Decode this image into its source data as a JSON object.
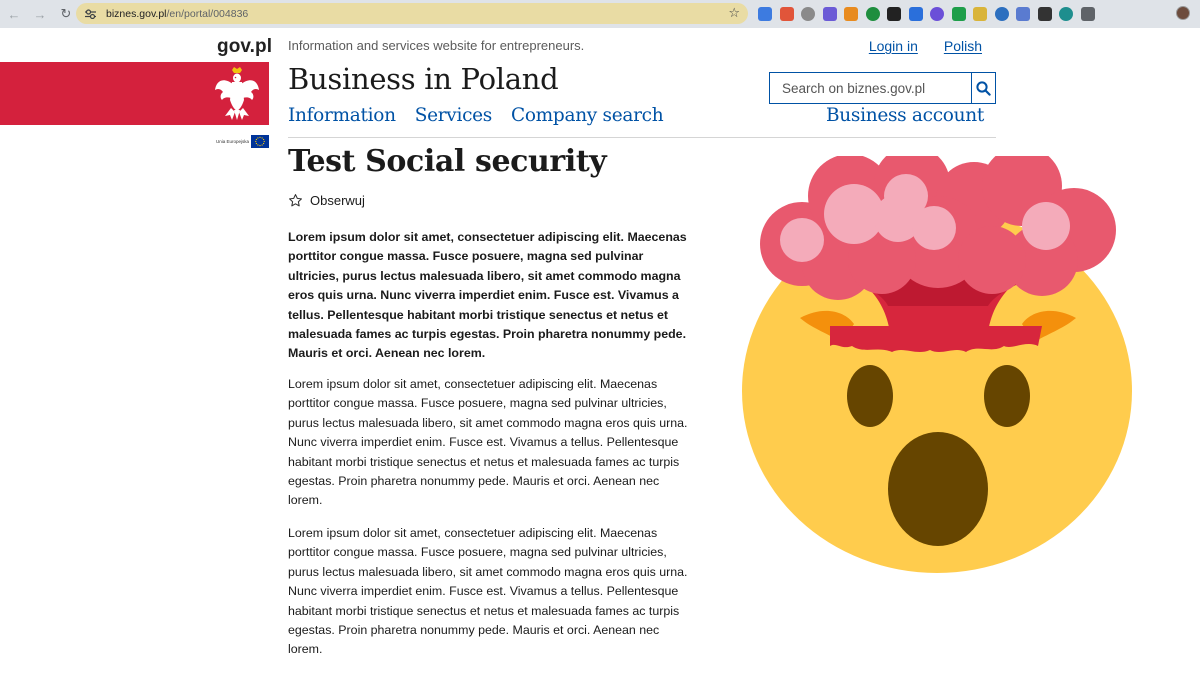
{
  "browser": {
    "url_host": "biznes.gov.pl",
    "url_path": "/en/portal/004836",
    "extension_colors": [
      "#3d7be0",
      "#e1553a",
      "#8a8a8a",
      "#6b5bd6",
      "#e88b1f",
      "#1e8e3e",
      "#222222",
      "#2a6fdb",
      "#6b4fd8",
      "#1e9e4a",
      "#d9b43a",
      "#2c6fbf",
      "#5a7bd0",
      "#333333",
      "#1e8e8e",
      "#5f6368"
    ]
  },
  "header": {
    "brand": "gov.pl",
    "eu_label": "Unia Europejska",
    "tagline": "Information and services website for entrepreneurs.",
    "login_link": "Login in",
    "language_link": "Polish",
    "site_title": "Business in Poland",
    "search_placeholder": "Search on biznes.gov.pl",
    "nav": [
      "Information",
      "Services",
      "Company search"
    ],
    "business_account": "Business account",
    "colors": {
      "link": "#0052a5",
      "flag_red": "#d4213d"
    }
  },
  "content": {
    "title": "Test Social security",
    "follow_label": "Obserwuj",
    "paragraphs": [
      "Lorem ipsum dolor sit amet, consectetuer adipiscing elit. Maecenas porttitor congue massa. Fusce posuere, magna sed pulvinar ultricies, purus lectus malesuada libero, sit amet commodo magna eros quis urna. Nunc viverra imperdiet enim. Fusce est. Vivamus a tellus. Pellentesque habitant morbi tristique senectus et netus et malesuada fames ac turpis egestas. Proin pharetra nonummy pede. Mauris et orci. Aenean nec lorem.",
      "Lorem ipsum dolor sit amet, consectetuer adipiscing elit. Maecenas porttitor congue massa. Fusce posuere, magna sed pulvinar ultricies, purus lectus malesuada libero, sit amet commodo magna eros quis urna. Nunc viverra imperdiet enim. Fusce est. Vivamus a tellus. Pellentesque habitant morbi tristique senectus et netus et malesuada fames ac turpis egestas. Proin pharetra nonummy pede. Mauris et orci. Aenean nec lorem.",
      "Lorem ipsum dolor sit amet, consectetuer adipiscing elit. Maecenas porttitor congue massa. Fusce posuere, magna sed pulvinar ultricies, purus lectus malesuada libero, sit amet commodo magna eros quis urna. Nunc viverra imperdiet enim. Fusce est. Vivamus a tellus. Pellentesque habitant morbi tristique senectus et netus et malesuada fames ac turpis egestas. Proin pharetra nonummy pede. Mauris et orci. Aenean nec lorem."
    ],
    "illustration": "exploding-head-emoji-icon"
  }
}
